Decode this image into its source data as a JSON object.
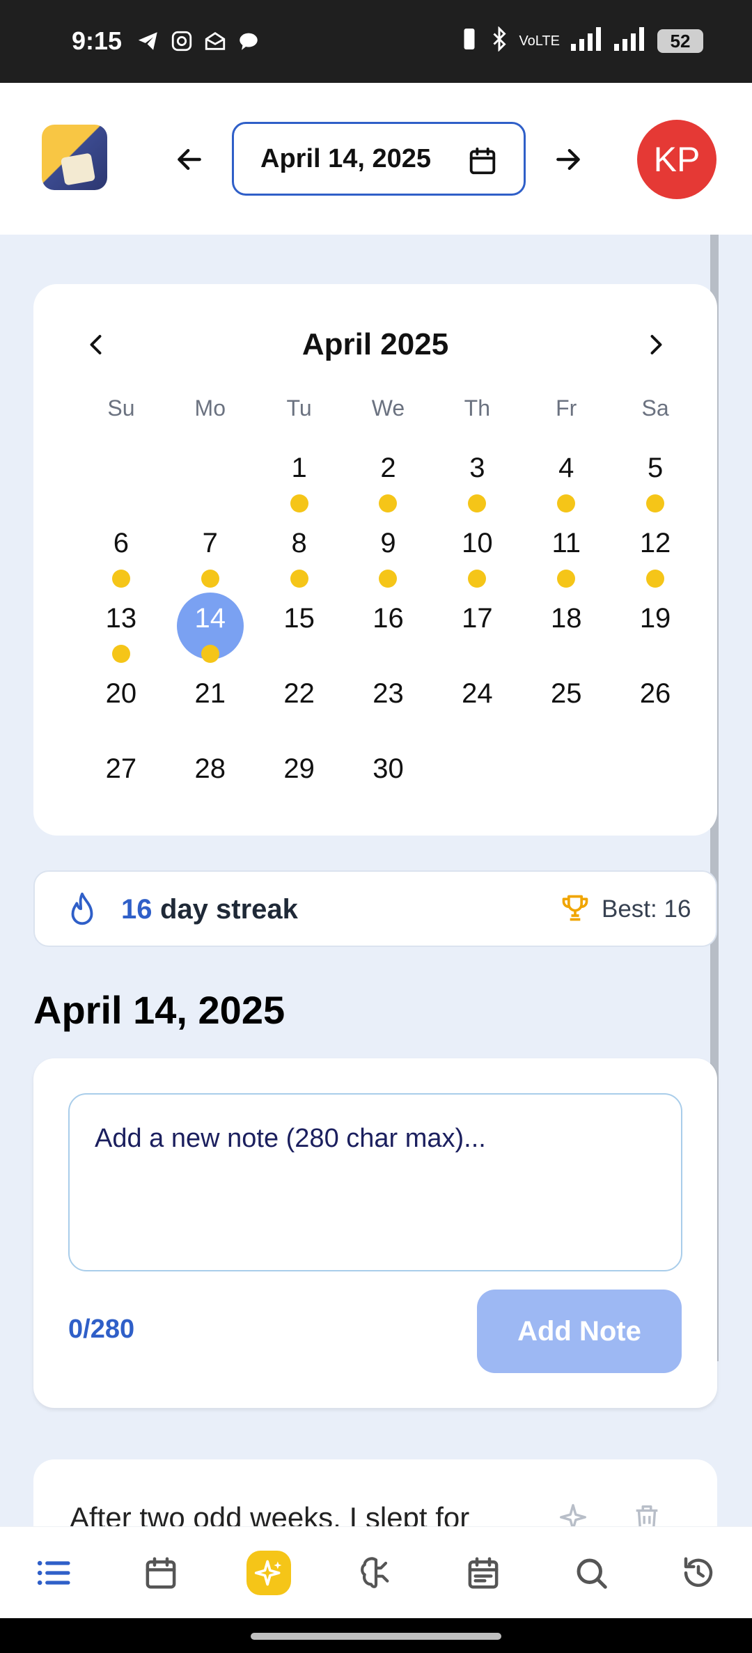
{
  "status_bar": {
    "time": "9:15",
    "network": "VoLTE",
    "battery": "52"
  },
  "header": {
    "selected_date": "April 14, 2025",
    "avatar_initials": "KP"
  },
  "calendar": {
    "month_label": "April 2025",
    "weekdays": [
      "Su",
      "Mo",
      "Tu",
      "We",
      "Th",
      "Fr",
      "Sa"
    ],
    "leading_blanks": 2,
    "days": [
      "1",
      "2",
      "3",
      "4",
      "5",
      "6",
      "7",
      "8",
      "9",
      "10",
      "11",
      "12",
      "13",
      "14",
      "15",
      "16",
      "17",
      "18",
      "19",
      "20",
      "21",
      "22",
      "23",
      "24",
      "25",
      "26",
      "27",
      "28",
      "29",
      "30"
    ],
    "days_with_notes": [
      1,
      2,
      3,
      4,
      5,
      6,
      7,
      8,
      9,
      10,
      11,
      12,
      13,
      14
    ],
    "selected_day": 14,
    "dot_color": "#f5c518",
    "selected_color": "#7aa1f2"
  },
  "streak": {
    "count": "16",
    "label": "day streak",
    "best": "Best: 16"
  },
  "notes_section": {
    "date_heading": "April 14, 2025",
    "input_placeholder": "Add a new note (280 char max)...",
    "char_count": "0/280",
    "add_button": "Add Note",
    "first_note_preview": "After two odd weeks, I slept for"
  },
  "colors": {
    "accent": "#2f5fc8",
    "background": "#e9eff9",
    "ai_highlight": "#f5c518",
    "avatar": "#e53935"
  },
  "bottom_nav": {
    "items": [
      "list-icon",
      "calendar-icon",
      "ai-sparkle-icon",
      "brain-icon",
      "calendar-planner-icon",
      "search-icon",
      "history-icon"
    ]
  }
}
